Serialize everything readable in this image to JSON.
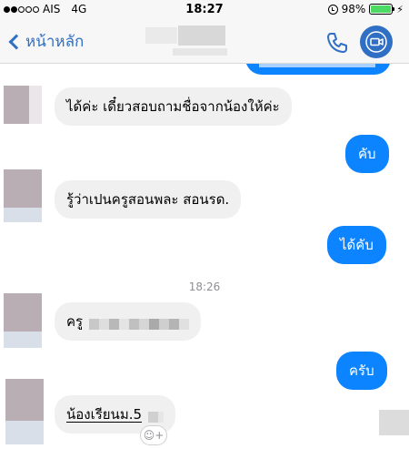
{
  "status_bar": {
    "carrier": "AIS",
    "network": "4G",
    "time": "18:27",
    "battery": "98%",
    "battery_level": 0.98,
    "signal_bars_filled": 2,
    "signal_bars_total": 5
  },
  "nav": {
    "back_label": "หน้าหลัก",
    "call_icon": "phone-icon",
    "video_icon": "video-camera-icon",
    "accent": "#2f6fc4"
  },
  "messages": {
    "m1": "ได้ค่ะ เดี๋ยวสอบถามชื่อจากน้องให้ค่ะ",
    "m2": "คับ",
    "m3": "รู้ว่าเปนครูสอนพละ สอนรด.",
    "m4": "ได้คับ",
    "timestamp": "18:26",
    "m5": "ครู",
    "m6": "ครับ",
    "m7": "น้องเรียนม.5"
  },
  "colors": {
    "outgoing_bubble": "#0c84ff",
    "incoming_bubble": "#f1f0f0",
    "timestamp": "#8e8e93"
  },
  "emoji_button": {
    "icon": "smiley-add-icon",
    "label": "☺+"
  }
}
